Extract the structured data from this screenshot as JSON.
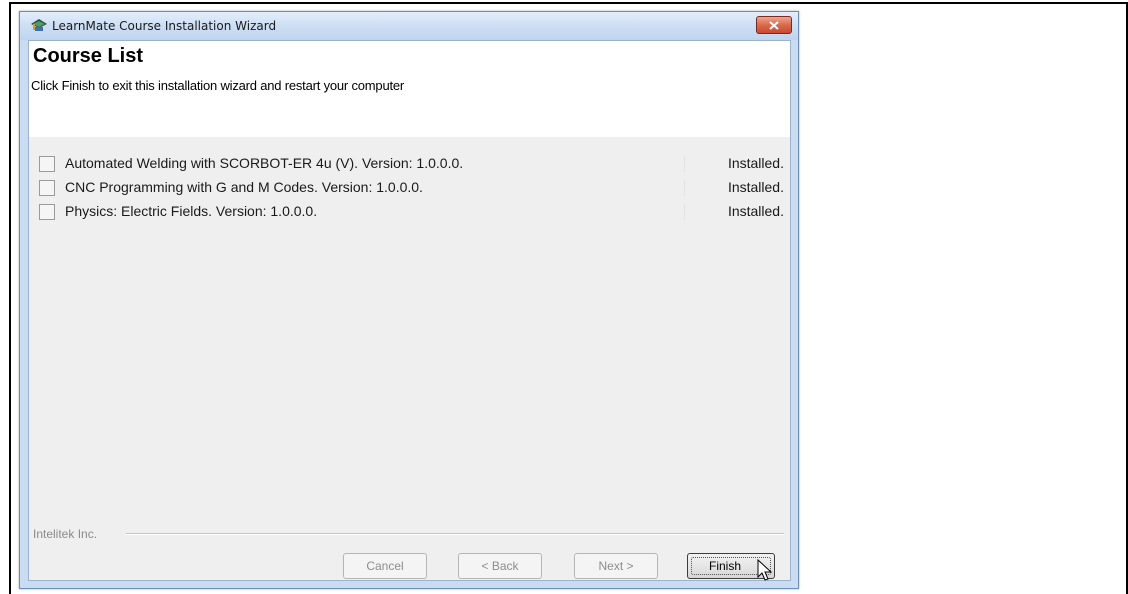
{
  "window": {
    "title": "LearnMate Course Installation Wizard"
  },
  "header": {
    "title": "Course List",
    "subtitle": "Click Finish to exit this installation wizard and restart your computer"
  },
  "courses": [
    {
      "name": "Automated Welding with SCORBOT-ER 4u (V).  Version: 1.0.0.0.",
      "status": "Installed.",
      "checked": false
    },
    {
      "name": "CNC Programming with G and M Codes.  Version: 1.0.0.0.",
      "status": "Installed.",
      "checked": false
    },
    {
      "name": "Physics: Electric Fields.  Version: 1.0.0.0.",
      "status": "Installed.",
      "checked": false
    }
  ],
  "footer": {
    "brand": "Intelitek Inc."
  },
  "buttons": {
    "cancel": "Cancel",
    "back": "< Back",
    "next": "Next >",
    "finish": "Finish"
  },
  "colors": {
    "close_button": "#d96a4d",
    "titlebar": "#cfe0f5",
    "client_background": "#efefef"
  },
  "icons": {
    "app": "graduation-cap-icon",
    "close": "close-icon",
    "cursor": "mouse-pointer-icon"
  }
}
